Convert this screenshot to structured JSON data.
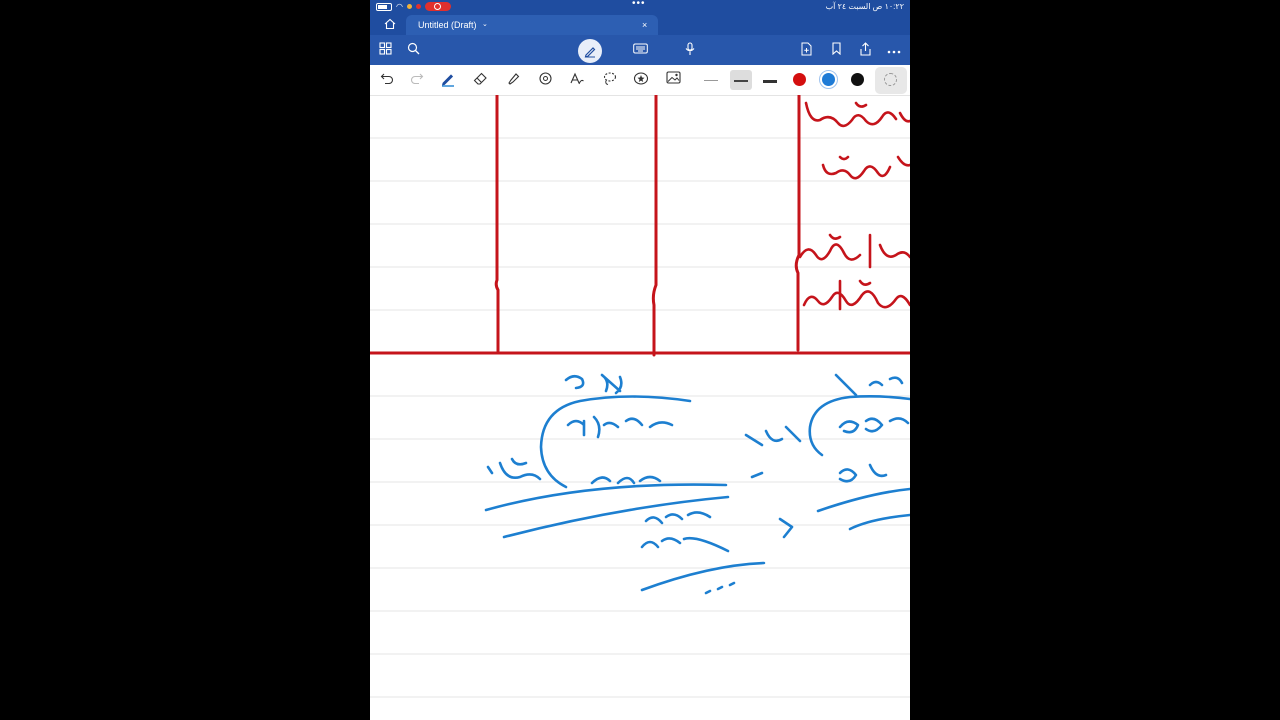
{
  "status_bar": {
    "clock": "١٠:٢٢ ص   السبت ٢٤ آب",
    "dots": "•••"
  },
  "tab_bar": {
    "title": "Untitled (Draft)",
    "chevron": "⌄",
    "close": "×"
  },
  "ribbon": {
    "icons": [
      "apps-grid-icon",
      "search-icon",
      "draw-pen-icon",
      "keyboard-icon",
      "microphone-icon",
      "new-page-icon",
      "bookmark-icon",
      "share-icon",
      "more-icon"
    ]
  },
  "toolbar": {
    "tools": [
      "undo-icon",
      "redo-icon",
      "ballpoint-pen-icon",
      "eraser-icon",
      "highlighter-icon",
      "ink-to-shape-icon",
      "ink-to-text-icon",
      "lasso-icon",
      "sticker-icon",
      "image-icon"
    ],
    "colors": {
      "red": "#d40f0f",
      "blue": "#1f7bd6",
      "black": "#111111"
    }
  },
  "canvas": {
    "ink_red": "#c5141b",
    "ink_blue": "#1d7fd0",
    "rule_color": "#e4e4e4"
  }
}
